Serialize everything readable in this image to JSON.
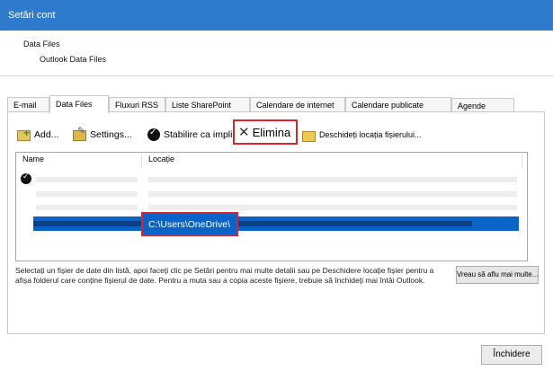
{
  "window": {
    "title": "Setări cont"
  },
  "header": {
    "line1": "Data Files",
    "line2": "Outlook Data Files"
  },
  "tabs": [
    {
      "label": "E-mail"
    },
    {
      "label": "Data Files"
    },
    {
      "label": "Fluxuri RSS"
    },
    {
      "label": "Liste SharePoint"
    },
    {
      "label": "Calendare de internet"
    },
    {
      "label": "Calendare publicate"
    },
    {
      "label": "Agende"
    }
  ],
  "toolbar": {
    "add": "Add...",
    "settings": "Settings...",
    "set_default": "Stabilire ca implic",
    "remove": "Elimina",
    "open_location": "Deschideți locația fișierului..."
  },
  "list": {
    "columns": [
      "Name",
      "Locație"
    ],
    "selected_path": "C:\\Users\\OneDrive\\"
  },
  "description": "Selectați un fișier de date din listă, apoi faceți clic pe Setări pentru mai multe detalii sau pe Deschidere locație fișier pentru a afișa folderul care conține fișierul de date. Pentru a muta sau a copia aceste fișiere, trebuie să închideți mai întâi Outlook.",
  "buttons": {
    "learn_more": "Vreau să aflu mai multe...",
    "close": "Închidere"
  },
  "colors": {
    "titlebar": "#2e7bce",
    "selection": "#0a64c8",
    "highlight_box": "#d9262c"
  }
}
